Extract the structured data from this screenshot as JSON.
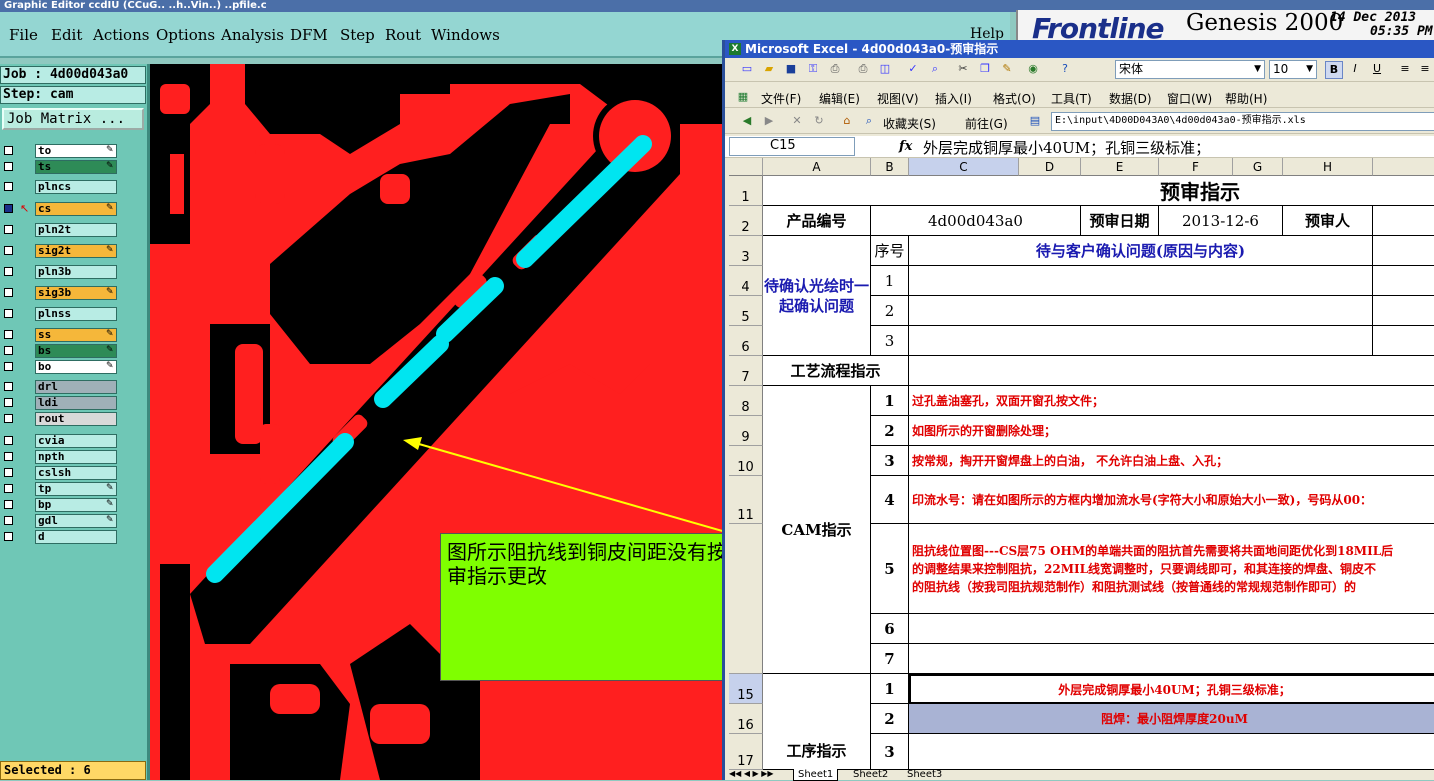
{
  "genesis": {
    "title_bar": "Graphic Editor ccdIU (CCuG..  ..h..Vin..) ..pfile.c",
    "menu": [
      "File",
      "Edit",
      "Actions",
      "Options",
      "Analysis",
      "DFM",
      "Step",
      "Rout",
      "Windows"
    ],
    "help": "Help",
    "brand": {
      "logo": "Frontline",
      "product": "Genesis 2000",
      "date": "14 Dec 2013",
      "time": "05:35 PM"
    },
    "job": "Job : 4d00d043a0",
    "step": "Step: cam",
    "job_matrix": "Job Matrix ...",
    "layers": [
      {
        "name": "to",
        "color": "#ffffff"
      },
      {
        "name": "ts",
        "color": "#2e8b57"
      },
      {
        "name": "plncs",
        "color": "#b8ece4"
      },
      {
        "name": "cs",
        "color": "#f5b73a"
      },
      {
        "name": "pln2t",
        "color": "#b8ece4"
      },
      {
        "name": "sig2t",
        "color": "#f5b73a"
      },
      {
        "name": "pln3b",
        "color": "#b8ece4"
      },
      {
        "name": "sig3b",
        "color": "#f5b73a"
      },
      {
        "name": "plnss",
        "color": "#b8ece4"
      },
      {
        "name": "ss",
        "color": "#f5b73a"
      },
      {
        "name": "bs",
        "color": "#2e8b57"
      },
      {
        "name": "bo",
        "color": "#ffffff"
      },
      {
        "name": "drl",
        "color": "#9fb0b8"
      },
      {
        "name": "ldi",
        "color": "#9fb0b8"
      },
      {
        "name": "rout",
        "color": "#d9d9d9"
      },
      {
        "name": "cvia",
        "color": "#b8ece4"
      },
      {
        "name": "npth",
        "color": "#b8ece4"
      },
      {
        "name": "cslsh",
        "color": "#b8ece4"
      },
      {
        "name": "tp",
        "color": "#b8ece4"
      },
      {
        "name": "bp",
        "color": "#b8ece4"
      },
      {
        "name": "gdl",
        "color": "#b8ece4"
      },
      {
        "name": "d",
        "color": "#b8ece4"
      }
    ],
    "selected": "Selected : 6",
    "annotation": "图所示阻抗线到铜皮间距没有按预审指示更改"
  },
  "excel": {
    "title": "Microsoft Excel - 4d00d043a0-预审指示",
    "font_name": "宋体",
    "font_size": "10",
    "menu": [
      "文件(F)",
      "编辑(E)",
      "视图(V)",
      "插入(I)",
      "格式(O)",
      "工具(T)",
      "数据(D)",
      "窗口(W)",
      "帮助(H)"
    ],
    "favorites": "收藏夹(S)",
    "goto": "前往(G)",
    "path": "E:\\input\\4D00D043A0\\4d00d043a0-预审指示.xls",
    "cell_ref": "C15",
    "formula": "外层完成铜厚最小40UM；孔铜三级标准；",
    "columns": [
      "A",
      "B",
      "C",
      "D",
      "E",
      "F",
      "G",
      "H"
    ],
    "rows": [
      "1",
      "2",
      "3",
      "4",
      "5",
      "6",
      "7",
      "8",
      "9",
      "10",
      "11",
      "15",
      "16",
      "17"
    ],
    "sheet_title": "预审指示",
    "product_label": "产品编号",
    "product_value": "4d00d043a0",
    "date_label": "预审日期",
    "date_value": "2013-12-6",
    "reviewer_label": "预审人",
    "seq_label": "序号",
    "confirm_header": "待与客户确认问题(原因与内容)",
    "confirm_section": "待确认光绘时一起确认问题",
    "confirm_nums": [
      "1",
      "2",
      "3"
    ],
    "process_label": "工艺流程指示",
    "cam_label": "CAM指示",
    "cam_items": [
      {
        "n": "1",
        "text": "过孔盖油塞孔，双面开窗孔按文件；"
      },
      {
        "n": "2",
        "text": "如图所示的开窗删除处理；"
      },
      {
        "n": "3",
        "text": "按常规，掏开开窗焊盘上的白油，  不允许白油上盘、入孔；"
      },
      {
        "n": "4",
        "text": "印流水号：请在如图所示的方框内增加流水号(字符大小和原始大小一致)，号码从00："
      },
      {
        "n": "5",
        "lines": [
          "阻抗线位置图---CS层75 OHM的单端共面的阻抗首先需要将共面地间距优化到18MIL后",
          "的调整结果来控制阻抗，22MIL线宽调整时，只要调线即可，和其连接的焊盘、铜皮不",
          "的阻抗线（按我司阻抗规范制作）和阻抗测试线（按普通线的常规规范制作即可）的"
        ]
      },
      {
        "n": "6",
        "text": ""
      },
      {
        "n": "7",
        "text": ""
      }
    ],
    "process2_label": "工序指示",
    "process2_items": [
      {
        "n": "1",
        "text": "外层完成铜厚最小40UM；孔铜三级标准；"
      },
      {
        "n": "2",
        "text": "阻焊：最小阻焊厚度20uM"
      },
      {
        "n": "3",
        "text": ""
      }
    ],
    "sheets": [
      "Sheet1",
      "Sheet2",
      "Sheet3"
    ]
  }
}
